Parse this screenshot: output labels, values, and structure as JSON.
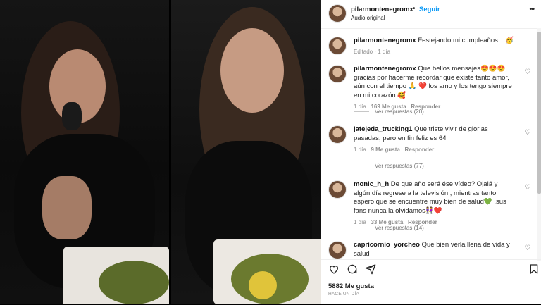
{
  "post": {
    "username": "pilarmontenegromx",
    "separator": "•",
    "follow_label": "Seguir",
    "audio": "Audio original",
    "more": "•••"
  },
  "caption": {
    "username": "pilarmontenegromx",
    "text": "Festejando mi cumpleaños... 🥳",
    "meta": "Editado · 1 día"
  },
  "comments": [
    {
      "username": "pilarmontenegromx",
      "text": "Que bellos mensajes😍😍😍 gracias por hacerme recordar que existe tanto amor, aún con el tiempo 🙏 ❤️ los amo y los tengo siempre en mi corazón 🥰",
      "time": "1 día",
      "likes": "169 Me gusta",
      "reply": "Responder",
      "view_replies": "Ver respuestas (20)"
    },
    {
      "username": "jatejeda_trucking1",
      "text": "Que triste vivir de glorias pasadas, pero en fin feliz es 64",
      "time": "1 día",
      "likes": "9 Me gusta",
      "reply": "Responder",
      "view_replies": "Ver respuestas (77)"
    },
    {
      "username": "monic_h_h",
      "text": "De que año será ése vídeo? Ojalá y algún día regrese a la televisión , mientras tanto espero que se encuentre muy bien de salud💚 ,sus fans nunca la olvidamos👭❤️",
      "time": "1 día",
      "likes": "33 Me gusta",
      "reply": "Responder",
      "view_replies": "Ver respuestas (14)"
    },
    {
      "username": "capricornio_yorcheo",
      "text": "Que bien verla llena de vida y salud"
    }
  ],
  "footer": {
    "likes": "5882 Me gusta",
    "time": "HACE UN DÍA"
  },
  "icons": {
    "heart": "heart-icon",
    "comment": "comment-icon",
    "share": "share-icon",
    "save": "bookmark-icon"
  }
}
